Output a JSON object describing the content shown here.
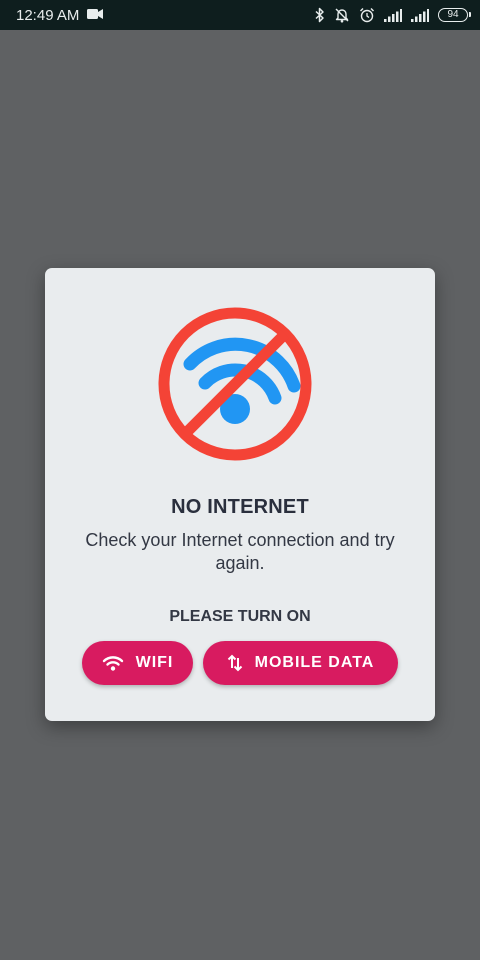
{
  "status_bar": {
    "time": "12:49 AM",
    "battery_level": "94",
    "icons": [
      "video-camera-icon",
      "bluetooth-icon",
      "notifications-off-icon",
      "alarm-icon",
      "signal-icon",
      "signal-icon",
      "battery-icon"
    ]
  },
  "dialog": {
    "title": "NO INTERNET",
    "message": "Check your Internet connection and try again.",
    "prompt": "PLEASE TURN ON",
    "hero_icon": "no-wifi-icon",
    "buttons": {
      "wifi": {
        "label": "WIFI",
        "icon": "wifi-icon"
      },
      "mobile_data": {
        "label": "MOBILE DATA",
        "icon": "data-transfer-icon"
      }
    }
  },
  "colors": {
    "status_bar_bg": "#0e1e1e",
    "scrim": "#5f6163",
    "dialog_bg": "#e9ecee",
    "accent": "#d81b60",
    "wifi_blue": "#2196f3",
    "prohibition_red": "#f44336"
  }
}
